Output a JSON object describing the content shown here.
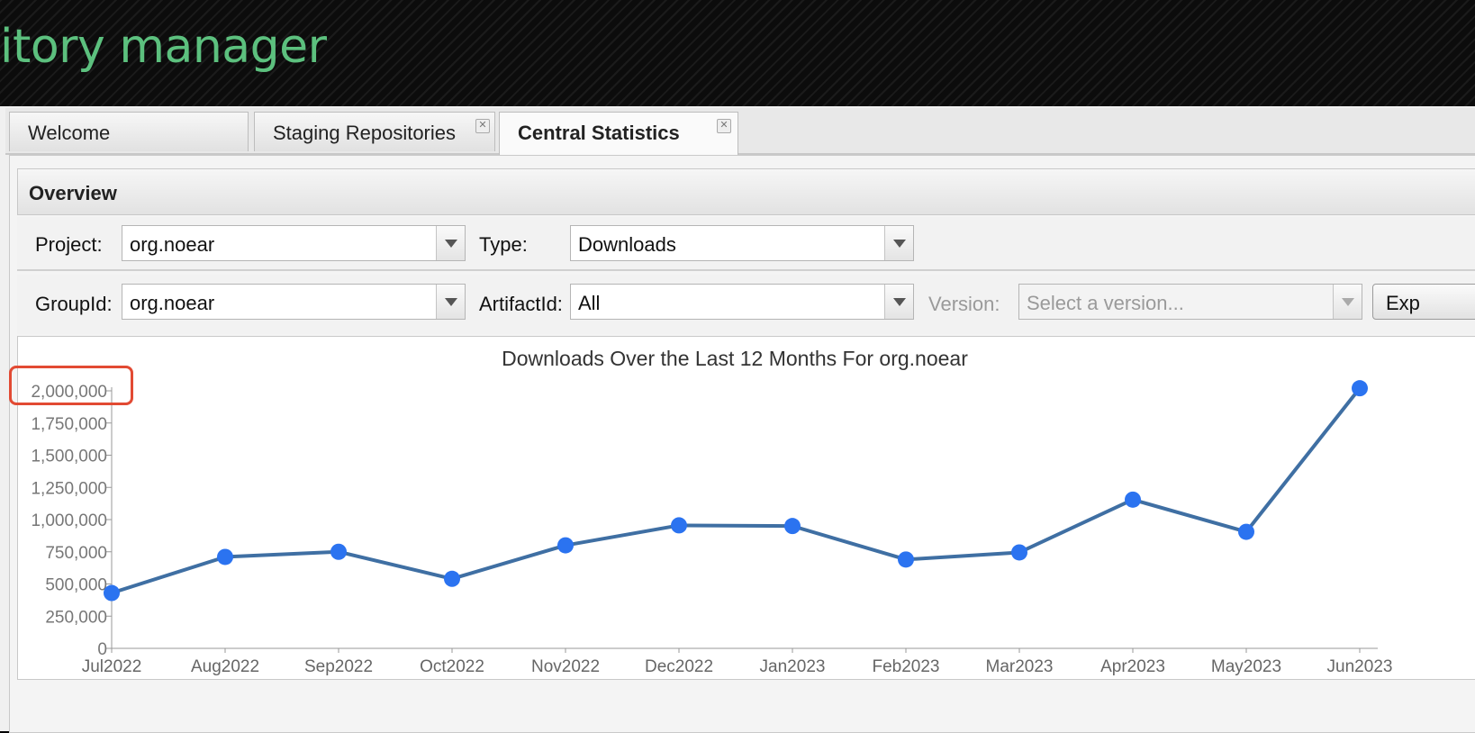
{
  "app": {
    "title_fragment": "itory manager"
  },
  "tabs": [
    {
      "label": "Welcome",
      "closable": false,
      "active": false
    },
    {
      "label": "Staging Repositories",
      "closable": true,
      "active": false
    },
    {
      "label": "Central Statistics",
      "closable": true,
      "active": true
    }
  ],
  "overview": {
    "title": "Overview",
    "project": {
      "label": "Project:",
      "value": "org.noear"
    },
    "type": {
      "label": "Type:",
      "value": "Downloads"
    },
    "groupid": {
      "label": "GroupId:",
      "value": "org.noear"
    },
    "artifactid": {
      "label": "ArtifactId:",
      "value": "All"
    },
    "version": {
      "label": "Version:",
      "placeholder": "Select a version..."
    },
    "export_button": "Exp"
  },
  "icons": {
    "close": "close-icon",
    "dropdown": "chevron-down-icon"
  },
  "colors": {
    "accent_green": "#5cc07e",
    "series_line": "#3f6fa3",
    "marker": "#2b73f0",
    "highlight": "#e24a33"
  },
  "chart_data": {
    "type": "line",
    "title": "Downloads Over the Last 12 Months For org.noear",
    "categories": [
      "Jul2022",
      "Aug2022",
      "Sep2022",
      "Oct2022",
      "Nov2022",
      "Dec2022",
      "Jan2023",
      "Feb2023",
      "Mar2023",
      "Apr2023",
      "May2023",
      "Jun2023"
    ],
    "series": [
      {
        "values": [
          430000,
          710000,
          750000,
          540000,
          800000,
          955000,
          950000,
          690000,
          745000,
          1155000,
          905000,
          2020000
        ]
      }
    ],
    "ylim": [
      0,
      2000000
    ],
    "yticks": [
      0,
      250000,
      500000,
      750000,
      1000000,
      1250000,
      1500000,
      1750000,
      2000000
    ],
    "ytick_labels": [
      "0",
      "250,000",
      "500,000",
      "750,000",
      "1,000,000",
      "1,250,000",
      "1,500,000",
      "1,750,000",
      "2,000,000"
    ],
    "xlabel": "",
    "ylabel": "",
    "grid": false
  }
}
